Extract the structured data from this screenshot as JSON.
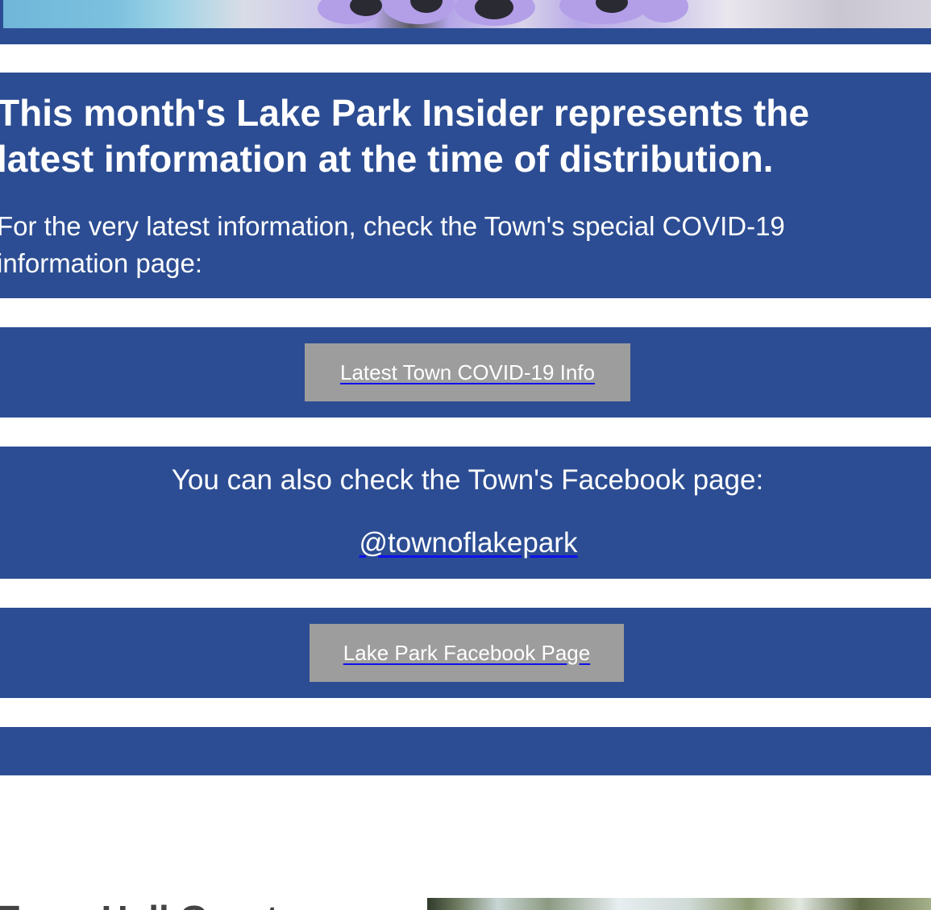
{
  "hero": {
    "image_name": "decorative-banner-image"
  },
  "notice": {
    "headline": "This month's Lake Park Insider represents the latest information at the time of distribution.",
    "intro": "For the very latest information, check the Town's special COVID-19 information page:"
  },
  "covid_button": {
    "label": "Latest Town COVID-19 Info"
  },
  "facebook": {
    "text": "You can also check the Town's Facebook page:",
    "handle": "@townoflakepark"
  },
  "facebook_button": {
    "label": "Lake Park Facebook Page"
  },
  "next_section": {
    "title": "Town Hall Grant"
  },
  "colors": {
    "band": "#2c4d93",
    "button": "#9d9d9d",
    "link_underline": "#1010ee",
    "title_text": "#444444"
  }
}
